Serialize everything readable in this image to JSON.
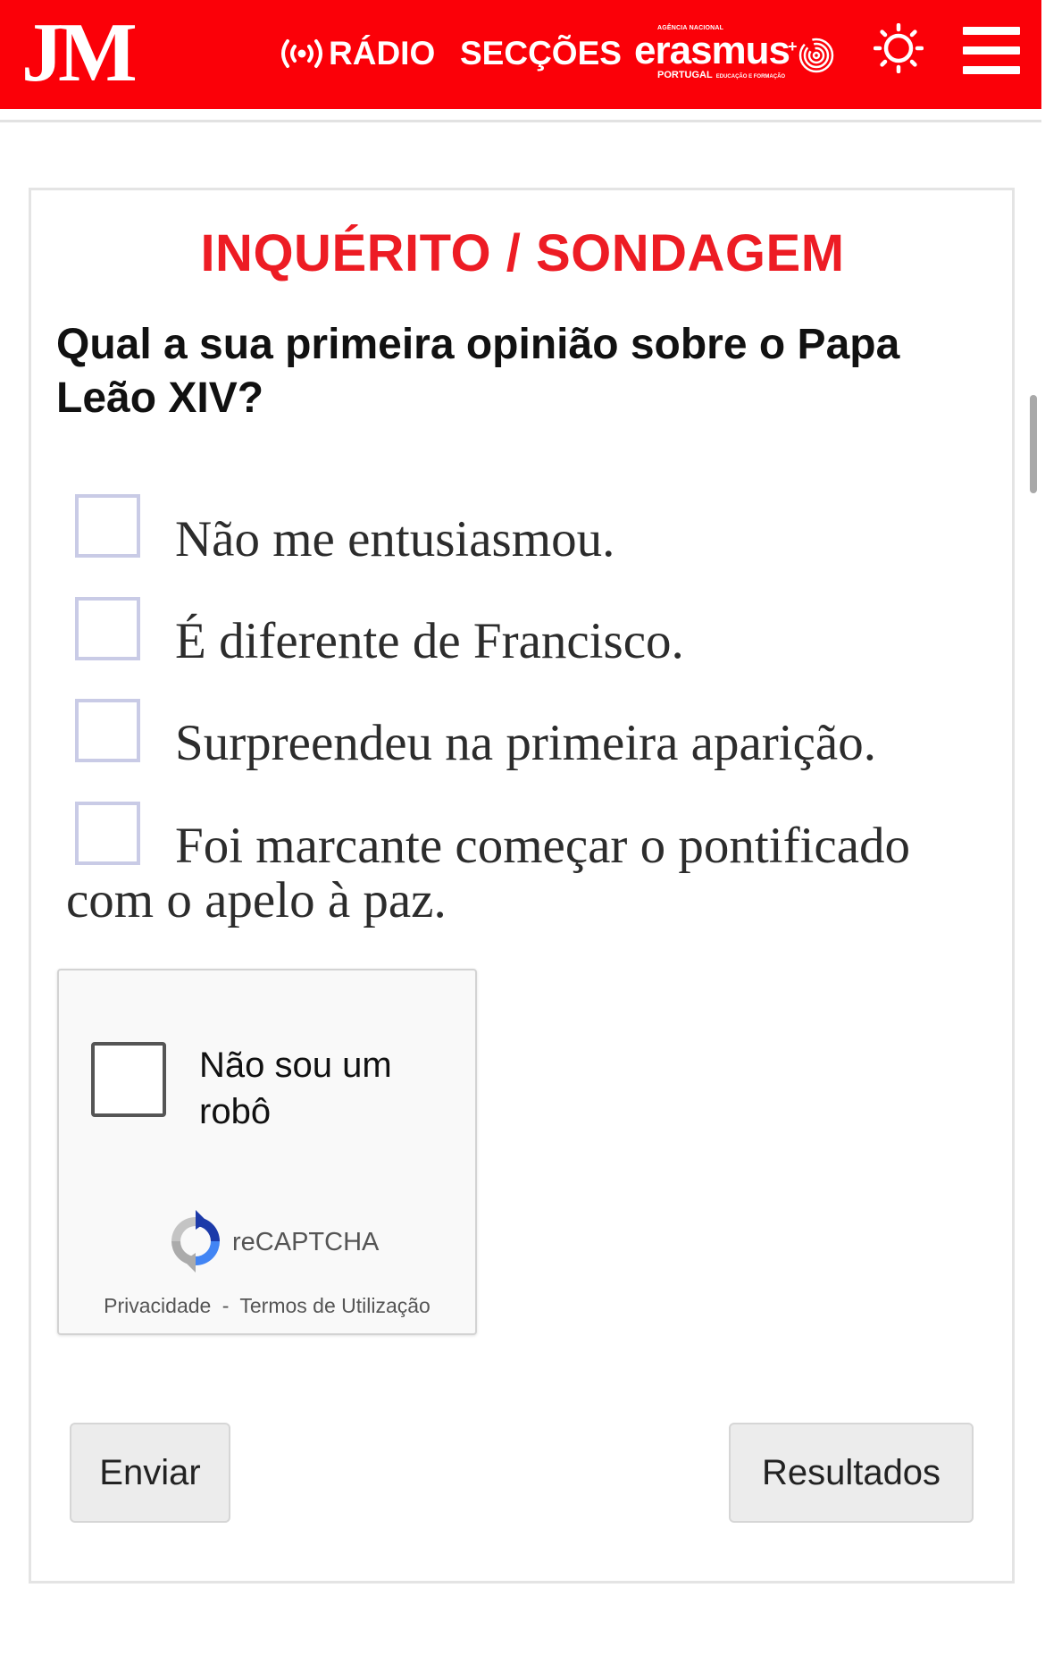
{
  "header": {
    "logo": "JM",
    "radio_label": "RÁDIO",
    "sections_label": "SECÇÕES",
    "partner": {
      "top_text": "AGÊNCIA NACIONAL",
      "name": "erasmus",
      "plus": "+",
      "country": "PORTUGAL",
      "subtitle": "EDUCAÇÃO E FORMAÇÃO"
    },
    "icons": {
      "radio": "radio-broadcast-icon",
      "theme": "sun-icon",
      "menu": "hamburger-menu-icon",
      "partner": "fingerprint-icon"
    },
    "colors": {
      "header_bg": "#fb0008"
    }
  },
  "survey": {
    "title": "INQUÉRITO / SONDAGEM",
    "question": "Qual a sua primeira opinião sobre o Papa Leão XIV?",
    "options": [
      "Não me entusiasmou.",
      "É diferente de Francisco.",
      "Surpreendeu na primeira aparição.",
      "Foi marcante começar o pontificado",
      "com o apelo à paz."
    ],
    "colors": {
      "title": "#ed1c24",
      "checkbox_border": "#c9cbe6"
    }
  },
  "captcha": {
    "label_line1": "Não sou um",
    "label_line2": "robô",
    "brand": "reCAPTCHA",
    "privacy": "Privacidade",
    "separator": "-",
    "terms": "Termos de Utilização"
  },
  "buttons": {
    "submit": "Enviar",
    "results": "Resultados"
  }
}
